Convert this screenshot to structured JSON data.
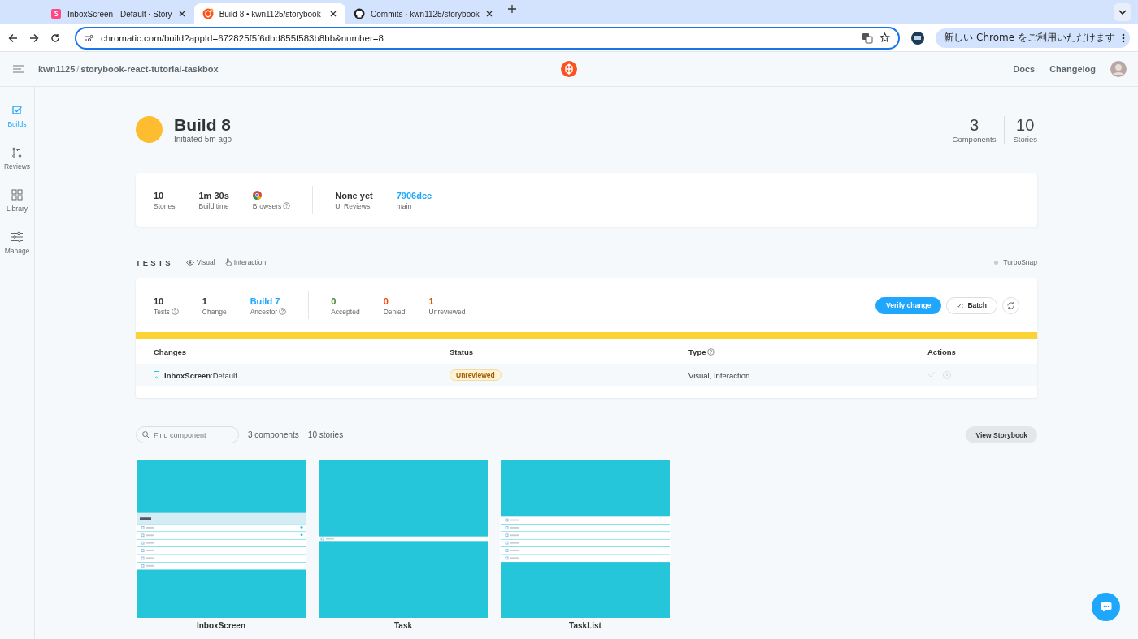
{
  "browser": {
    "tabs": [
      {
        "title": "InboxScreen - Default ⋅ Story",
        "kind": "storybook",
        "selected": false
      },
      {
        "title": "Build 8 • kwn1125/storybook-",
        "kind": "chromatic",
        "selected": true
      },
      {
        "title": "Commits · kwn1125/storybook",
        "kind": "github",
        "selected": false
      }
    ],
    "url": "chromatic.com/build?appId=672825f5f6dbd855f583b8bb&number=8",
    "update_button": "新しい Chrome をご利用いただけます"
  },
  "header": {
    "owner": "kwn1125",
    "separator": "/",
    "repo": "storybook-react-tutorial-taskbox",
    "links": [
      "Docs",
      "Changelog"
    ]
  },
  "sidebar": {
    "items": [
      {
        "label": "Builds",
        "kind": "builds",
        "selected": true
      },
      {
        "label": "Reviews",
        "kind": "reviews",
        "selected": false
      },
      {
        "label": "Library",
        "kind": "library",
        "selected": false
      },
      {
        "label": "Manage",
        "kind": "manage",
        "selected": false
      }
    ]
  },
  "build": {
    "title": "Build 8",
    "subtitle": "Initiated 5m ago",
    "counts": [
      {
        "value": "3",
        "label": "Components"
      },
      {
        "value": "10",
        "label": "Stories"
      }
    ]
  },
  "summary": {
    "groups": [
      [
        {
          "kind": "text",
          "value": "10",
          "label": "Stories",
          "help": false
        },
        {
          "kind": "text",
          "value": "1m 30s",
          "label": "Build time",
          "help": false
        },
        {
          "kind": "browsers",
          "label": "Browsers",
          "help": true
        }
      ],
      [
        {
          "kind": "text",
          "value": "None yet",
          "label": "UI Reviews",
          "help": false
        },
        {
          "kind": "link",
          "value": "7906dcc",
          "label": "main",
          "help": false
        }
      ]
    ]
  },
  "tests": {
    "heading": "TESTS",
    "filters": [
      {
        "kind": "eye",
        "label": "Visual"
      },
      {
        "kind": "hand",
        "label": "Interaction"
      }
    ],
    "turbosnap": "TurboSnap",
    "groups": [
      [
        {
          "value": "10",
          "label": "Tests",
          "help": true,
          "color": "#333333"
        },
        {
          "value": "1",
          "label": "Change",
          "help": false,
          "color": "#333333"
        },
        {
          "value": "Build 7",
          "label": "Ancestor",
          "help": true,
          "color": "#1ea7fd"
        }
      ],
      [
        {
          "value": "0",
          "label": "Accepted",
          "help": false,
          "color": "#448028"
        },
        {
          "value": "0",
          "label": "Denied",
          "help": false,
          "color": "#ff4400"
        },
        {
          "value": "1",
          "label": "Unreviewed",
          "help": false,
          "color": "#d45400"
        }
      ]
    ],
    "verify_button": "Verify change",
    "batch_button": "Batch",
    "columns": [
      {
        "label": "Changes",
        "help": false
      },
      {
        "label": "Status",
        "help": false
      },
      {
        "label": "Type",
        "help": true
      },
      {
        "label": "Actions",
        "help": false
      }
    ],
    "rows": [
      {
        "change": "**InboxScreen**:Default",
        "status": "Unreviewed",
        "type": "Visual, Interaction"
      }
    ]
  },
  "library": {
    "search": {
      "placeholder": "Find component"
    },
    "components_count": "3 components",
    "stories_count": "10 stories",
    "storybook_button": "View Storybook",
    "cards": [
      {
        "name": "InboxScreen",
        "kind": "inbox"
      },
      {
        "name": "Task",
        "kind": "task"
      },
      {
        "name": "TaskList",
        "kind": "list"
      }
    ]
  }
}
